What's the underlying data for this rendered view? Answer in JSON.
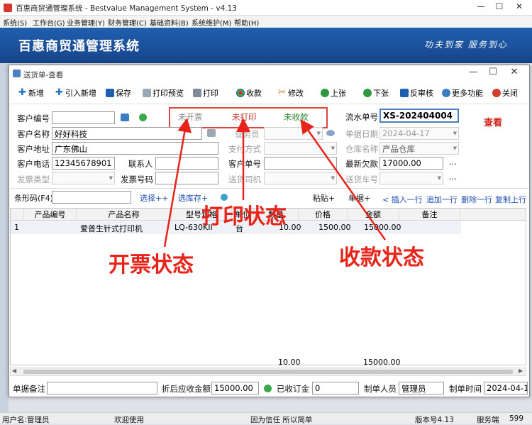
{
  "app": {
    "title": "百惠商贸通管理系统 - Bestvalue Management System - v4.13"
  },
  "menu": [
    "系统(S)",
    "工作台(G)",
    "业务管理(Y)",
    "财务管理(C)",
    "基础资料(B)",
    "系统维护(M)",
    "帮助(H)"
  ],
  "banner": {
    "system_name": "百惠商贸通管理系统",
    "slogan": "功夫到家 服务到心"
  },
  "window": {
    "title": "送货单-查看"
  },
  "toolbar": {
    "new": "新增",
    "import_new": "引入新增",
    "save": "保存",
    "print_preview": "打印预览",
    "print": "打印",
    "receive": "收款",
    "modify": "修改",
    "prev": "上张",
    "next": "下张",
    "unapprove": "反审核",
    "more": "更多功能",
    "close": "关闭"
  },
  "status": {
    "invoice": "未开票",
    "print": "未打印",
    "payment": "未收款",
    "mode": "查看"
  },
  "form": {
    "customer_no_label": "客户编号",
    "customer_no": "",
    "customer_name_label": "客户名称",
    "customer_name": "好好科技",
    "customer_addr_label": "客户地址",
    "customer_addr": "广东佛山",
    "customer_phone_label": "客户电话",
    "customer_phone": "12345678901",
    "contact_label": "联系人",
    "contact": "",
    "customer_order_label": "客户单号",
    "customer_order": "",
    "invoice_type_label": "发票类型",
    "invoice_type": "",
    "invoice_no_label": "发票号码",
    "invoice_no": "",
    "salesman_label": "业务员",
    "pay_method_label": "支付方式",
    "driver_label": "送货司机",
    "serial_no_label": "流水单号",
    "serial_no": "XS-202404004",
    "doc_date_label": "单据日期",
    "doc_date": "2024-04-17",
    "warehouse_label": "仓库名称",
    "warehouse": "产品仓库",
    "latest_debt_label": "最新欠款",
    "latest_debt": "17000.00",
    "car_no_label": "送货车号",
    "ellipsis": "..."
  },
  "grid_toolbar": {
    "barcode_label": "条形码(F4)",
    "select": "选择++",
    "select_stock": "选库存+",
    "paste": "粘贴+",
    "doc": "单据+",
    "insert": "< 插入一行",
    "append": "追加一行",
    "delete": "删除一行",
    "copy": "复制上行"
  },
  "table": {
    "headers": [
      "产品编号",
      "产品名称",
      "型号规格",
      "单位",
      "数量",
      "价格",
      "金额",
      "备注"
    ],
    "rows": [
      {
        "no": "1",
        "code": "",
        "name": "爱普生针式打印机",
        "model": "LQ-630KII",
        "unit": "台",
        "qty": "10.00",
        "price": "1500.00",
        "amount": "15000.00",
        "note": ""
      }
    ],
    "totals": {
      "qty": "10.00",
      "amount": "15000.00"
    }
  },
  "footer": {
    "remark_label": "单据备注",
    "remark": "",
    "receivable_label": "折后应收金额",
    "receivable": "15000.00",
    "deposit_label": "已收订金",
    "deposit": "0",
    "creator_label": "制单人员",
    "creator": "管理员",
    "time_label": "制单时间",
    "time": "2024-04-17"
  },
  "annotations": {
    "invoice": "开票状态",
    "print": "打印状态",
    "payment": "收款状态"
  },
  "statusbar": {
    "user": "用户名:管理员",
    "welcome": "欢迎使用",
    "motto": "因为信任 所以简单",
    "version": "版本号4.13",
    "server": "服务端",
    "count": "599"
  },
  "colors": {
    "banner": "#1b4f98",
    "annotation": "#e8231a",
    "status_green": "#2f8a2f",
    "status_red": "#c0392b"
  }
}
